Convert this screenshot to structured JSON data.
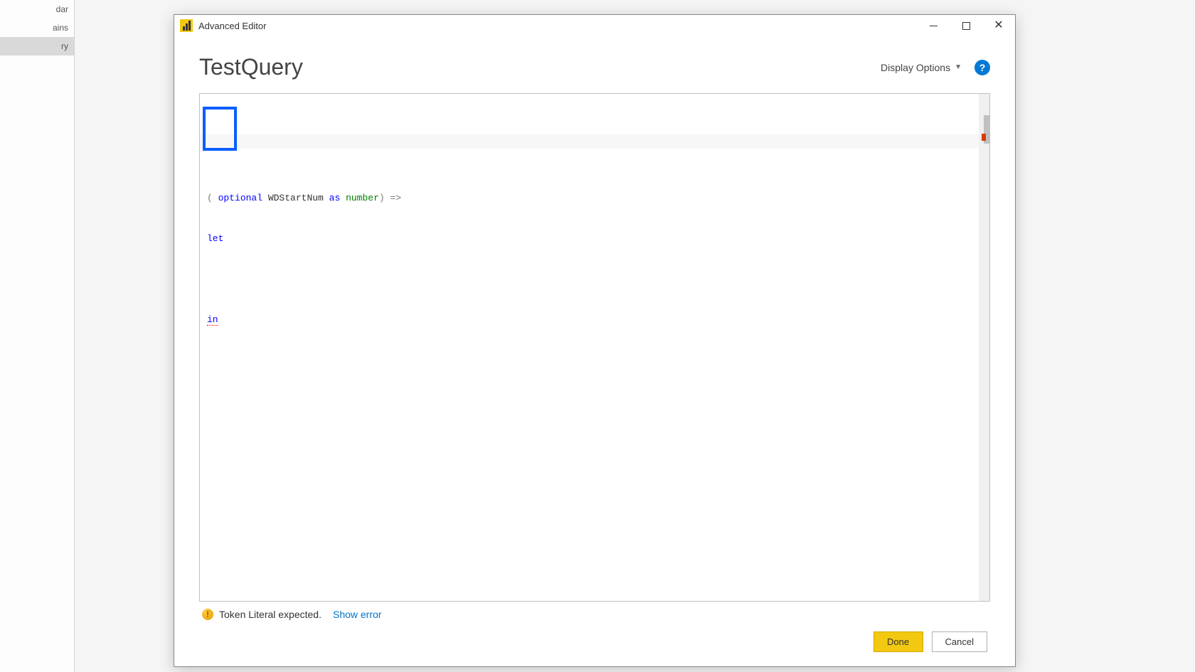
{
  "backgroundSidebar": {
    "items": [
      {
        "label": "dar"
      },
      {
        "label": "ains"
      },
      {
        "label": "ry"
      }
    ],
    "selectedIndex": 2
  },
  "window": {
    "title": "Advanced Editor"
  },
  "header": {
    "queryName": "TestQuery",
    "displayOptionsLabel": "Display Options"
  },
  "code": {
    "line1": {
      "prefix": "( ",
      "keyword1": "optional",
      "param": " WDStartNum ",
      "keyword2": "as",
      "space": " ",
      "type": "number",
      "suffix": ") =>"
    },
    "line2": "let",
    "line3": "",
    "line4": "in"
  },
  "status": {
    "message": "Token Literal expected.",
    "linkLabel": "Show error"
  },
  "buttons": {
    "done": "Done",
    "cancel": "Cancel"
  }
}
